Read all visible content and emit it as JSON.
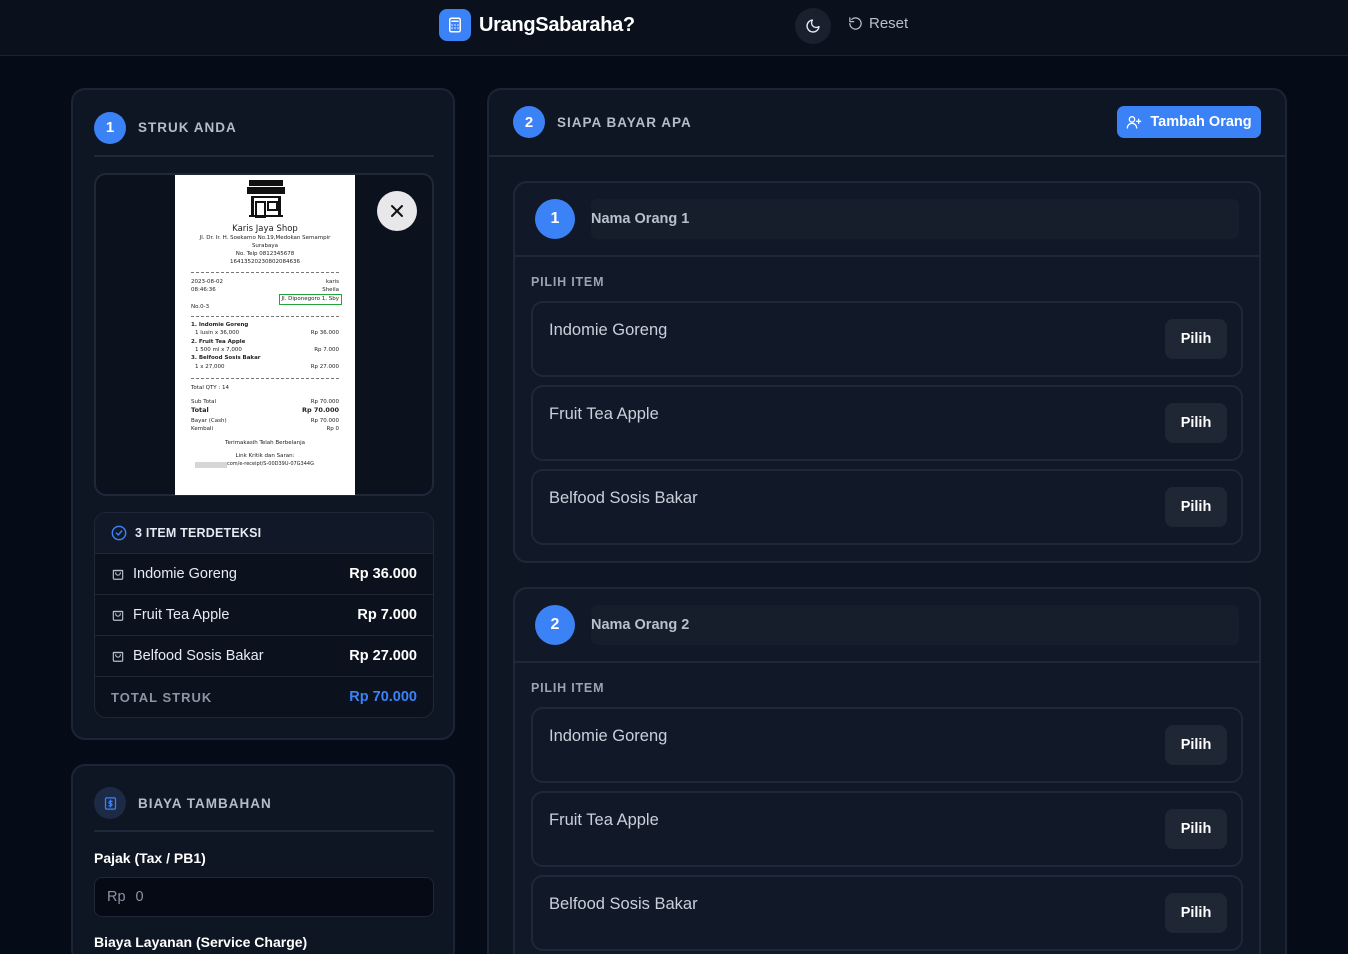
{
  "header": {
    "app_name": "UrangSabaraha?",
    "reset_label": "Reset"
  },
  "receipt_section": {
    "step": "1",
    "title": "STRUK ANDA",
    "receipt": {
      "shop_name": "Karis Jaya Shop",
      "address_line1": "Jl. Dr. Ir. H. Soekarno No.19,Medokan Semampir",
      "address_line2": "Surabaya",
      "phone": "No. Telp 0812345678",
      "code": "16413520230802084636",
      "date": "2023-08-02",
      "time": "08:46:36",
      "cashier": "karis",
      "customer": "Sheila",
      "highlight": "Jl. Diponegoro 1, Sby",
      "number": "No.0-3",
      "lines": [
        {
          "title": "1. Indomie Goreng",
          "detail": "1 lusin x 36,000",
          "amount": "Rp 36.000"
        },
        {
          "title": "2. Fruit Tea Apple",
          "detail": "1 500 ml x 7,000",
          "amount": "Rp 7.000"
        },
        {
          "title": "3. Belfood Sosis Bakar",
          "detail": "1 x 27,000",
          "amount": "Rp 27.000"
        }
      ],
      "total_qty": "Total QTY : 14",
      "sub_total_label": "Sub Total",
      "sub_total": "Rp 70.000",
      "total_label": "Total",
      "total": "Rp 70.000",
      "pay_label": "Bayar (Cash)",
      "pay": "Rp 70.000",
      "change_label": "Kembali",
      "change": "Rp 0",
      "thanks": "Terimakasih Telah Berbelanja",
      "feedback": "Link Kritik dan Saran:",
      "link": "com/e-receipt/S-00D39U-07G344G"
    },
    "detected_title": "3 ITEM TERDETEKSI",
    "items": [
      {
        "name": "Indomie Goreng",
        "price": "Rp 36.000"
      },
      {
        "name": "Fruit Tea Apple",
        "price": "Rp 7.000"
      },
      {
        "name": "Belfood Sosis Bakar",
        "price": "Rp 27.000"
      }
    ],
    "total_label": "TOTAL STRUK",
    "total_value": "Rp 70.000"
  },
  "extra_fees": {
    "title": "BIAYA TAMBAHAN",
    "tax_label": "Pajak (Tax / PB1)",
    "currency": "Rp",
    "tax_value": "0",
    "service_label": "Biaya Layanan (Service Charge)"
  },
  "people_section": {
    "step": "2",
    "title": "SIAPA BAYAR APA",
    "add_label": "Tambah Orang",
    "pick_label": "PILIH ITEM",
    "pick_button": "Pilih",
    "people": [
      {
        "number": "1",
        "name_placeholder": "Nama Orang 1",
        "items": [
          "Indomie Goreng",
          "Fruit Tea Apple",
          "Belfood Sosis Bakar"
        ]
      },
      {
        "number": "2",
        "name_placeholder": "Nama Orang 2",
        "items": [
          "Indomie Goreng",
          "Fruit Tea Apple",
          "Belfood Sosis Bakar"
        ]
      }
    ]
  },
  "colors": {
    "accent": "#3b82f6",
    "background": "#050b17",
    "card": "#0f1623"
  }
}
